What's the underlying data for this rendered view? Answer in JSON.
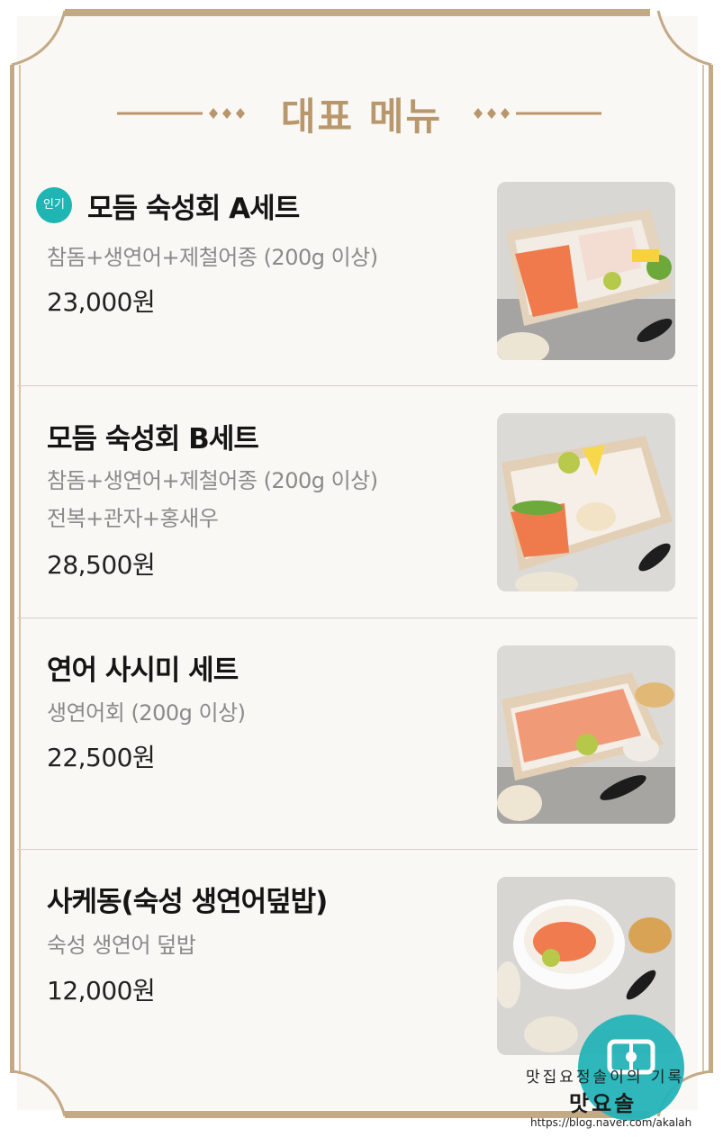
{
  "header": {
    "title": "대표 메뉴"
  },
  "items": [
    {
      "badge": "인기",
      "name": "모듬 숙성회 A세트",
      "desc": [
        "참돔+생연어+제철어종 (200g 이상)"
      ],
      "price": "23,000원"
    },
    {
      "name": "모듬 숙성회 B세트",
      "desc": [
        "참돔+생연어+제철어종 (200g 이상)",
        "전복+관자+홍새우"
      ],
      "price": "28,500원"
    },
    {
      "name": "연어 사시미 세트",
      "desc": [
        "생연어회 (200g 이상)"
      ],
      "price": "22,500원"
    },
    {
      "name": "사케동(숙성 생연어덮밥)",
      "desc": [
        "숙성 생연어 덮밥"
      ],
      "price": "12,000원"
    }
  ],
  "watermark": {
    "line1": "맛집요정솔이의 기록",
    "line2": "맛요솔",
    "url": "https://blog.naver.com/akalah"
  },
  "colors": {
    "frame": "#c7ad8b",
    "accent": "#b9976c",
    "badge": "#1fb5b3"
  }
}
